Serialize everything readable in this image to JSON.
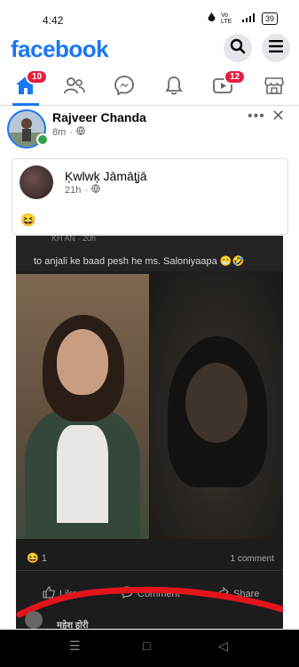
{
  "status_bar": {
    "time": "4:42",
    "network_label": "Vo LTE",
    "battery": "39"
  },
  "header": {
    "logo": "facebook",
    "search_icon": "search-icon",
    "menu_icon": "menu-icon"
  },
  "nav": {
    "items": [
      {
        "icon": "home-icon",
        "badge": "10",
        "active": true
      },
      {
        "icon": "friends-icon",
        "badge": ""
      },
      {
        "icon": "messenger-icon",
        "badge": ""
      },
      {
        "icon": "bell-icon",
        "badge": ""
      },
      {
        "icon": "video-icon",
        "badge": "12"
      },
      {
        "icon": "marketplace-icon",
        "badge": ""
      }
    ]
  },
  "post": {
    "author": "Rajveer Chanda",
    "time": "8m",
    "privacy_icon": "globe-icon",
    "more_label": "•••",
    "close_label": "✕"
  },
  "shared_post": {
    "author": "Ķwlwķ Jāmāţjā",
    "time": "21h",
    "emoji": "😆"
  },
  "screenshot": {
    "header_text": "KH AN · 20h",
    "text": "to anjali ke baad pesh he ms. Saloniyaapa 😁🤣",
    "reaction_count": "1",
    "comments": "1 comment",
    "like_label": "Like",
    "comment_label": "Comment",
    "share_label": "Share",
    "commenter": "महेश होरी"
  },
  "system_nav": {
    "menu": "☰",
    "home": "□",
    "back": "◁"
  },
  "colors": {
    "brand": "#1877f2",
    "badge": "#e41e3f",
    "online": "#31a24c"
  }
}
